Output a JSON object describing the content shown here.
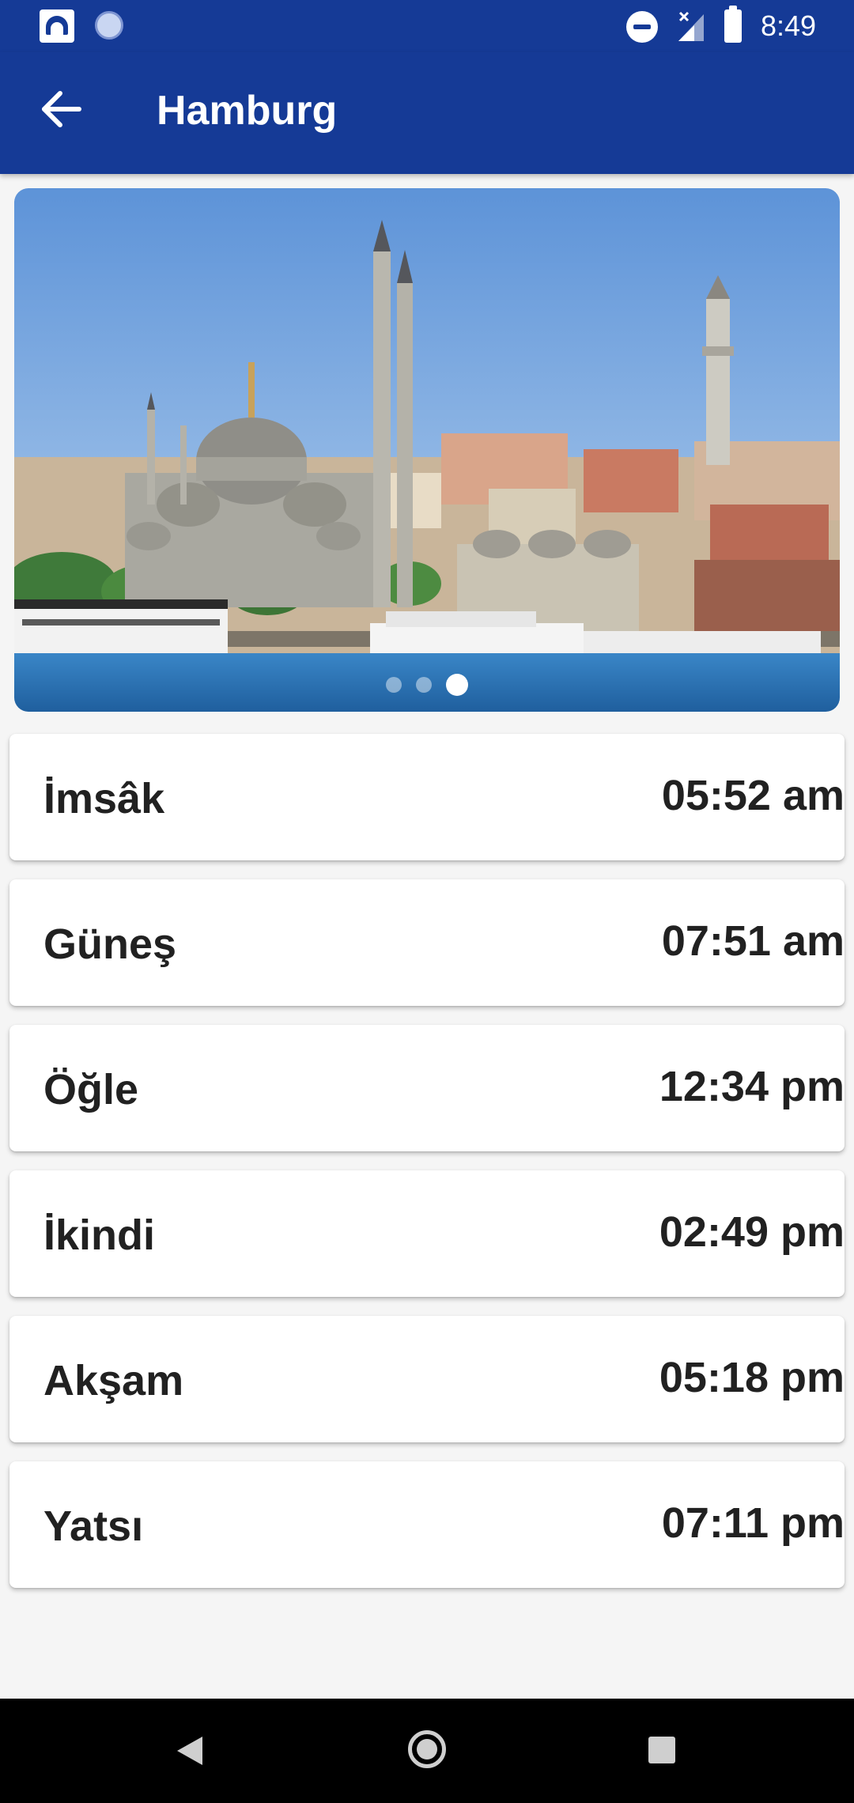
{
  "status_bar": {
    "time": "8:49",
    "icons": [
      "app-logo-icon",
      "sync-icon",
      "do-not-disturb-icon",
      "signal-icon",
      "battery-icon"
    ]
  },
  "app_bar": {
    "title": "Hamburg",
    "back_icon": "arrow-left-icon"
  },
  "carousel": {
    "slide_count": 3,
    "active_index": 2
  },
  "prayer_times": [
    {
      "name": "İmsâk",
      "time": "05:52 am"
    },
    {
      "name": "Güneş",
      "time": "07:51 am"
    },
    {
      "name": "Öğle",
      "time": "12:34 pm"
    },
    {
      "name": "İkindi",
      "time": "02:49 pm"
    },
    {
      "name": "Akşam",
      "time": "05:18 pm"
    },
    {
      "name": "Yatsı",
      "time": "07:11 pm"
    }
  ],
  "colors": {
    "primary": "#153a96",
    "card": "#ffffff",
    "text": "#212121"
  },
  "nav_bar": {
    "icons": [
      "nav-back-icon",
      "nav-home-icon",
      "nav-recents-icon"
    ]
  }
}
